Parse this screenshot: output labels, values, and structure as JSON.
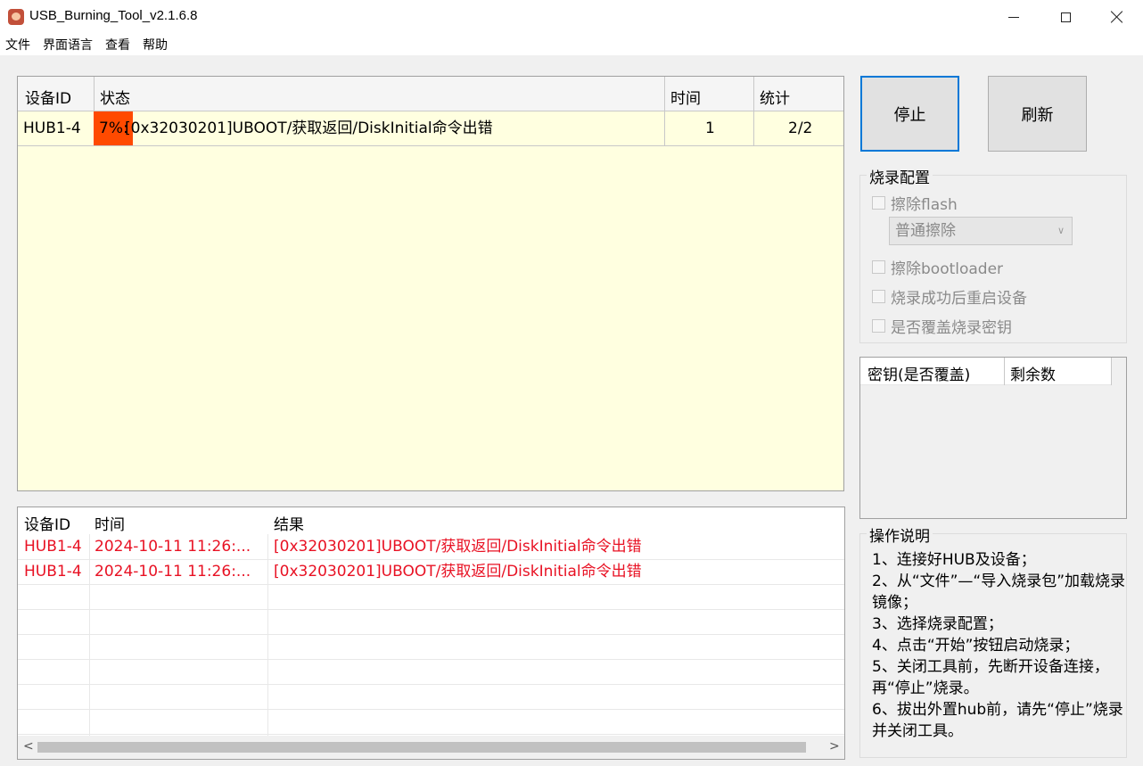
{
  "window": {
    "title": "USB_Burning_Tool_v2.1.6.8"
  },
  "menu": [
    "文件",
    "界面语言",
    "查看",
    "帮助"
  ],
  "device_table": {
    "headers": [
      "设备ID",
      "状态",
      "时间",
      "统计"
    ],
    "rows": [
      {
        "device_id": "HUB1-4",
        "progress_label": "7%:",
        "progress_percent": 7,
        "status": "[0x32030201]UBOOT/获取返回/DiskInitial命令出错",
        "time": "1",
        "stats": "2/2",
        "progress_color": "#ff4a00"
      }
    ],
    "background_color": "#ffffe0"
  },
  "buttons": {
    "stop": "停止",
    "refresh": "刷新"
  },
  "burn_config": {
    "title": "烧录配置",
    "erase_flash": "擦除flash",
    "erase_mode": "普通擦除",
    "erase_bootloader": "擦除bootloader",
    "reboot_after_success": "烧录成功后重启设备",
    "overwrite_key": "是否覆盖烧录密钥"
  },
  "key_list": {
    "headers": [
      "密钥(是否覆盖)",
      "剩余数"
    ]
  },
  "instructions": {
    "title": "操作说明",
    "lines": [
      "1、连接好HUB及设备；",
      "2、从“文件”—“导入烧录包”加载烧录镜像；",
      "3、选择烧录配置；",
      "4、点击“开始”按钮启动烧录；",
      "5、关闭工具前，先断开设备连接，再“停止”烧录。",
      "6、拔出外置hub前，请先“停止”烧录并关闭工具。"
    ]
  },
  "log_table": {
    "headers": [
      "设备ID",
      "时间",
      "结果"
    ],
    "rows": [
      {
        "device_id": "HUB1-4",
        "time": "2024-10-11 11:26:...",
        "result": "[0x32030201]UBOOT/获取返回/DiskInitial命令出错"
      },
      {
        "device_id": "HUB1-4",
        "time": "2024-10-11 11:26:...",
        "result": "[0x32030201]UBOOT/获取返回/DiskInitial命令出错"
      }
    ],
    "error_color": "#e81123"
  }
}
